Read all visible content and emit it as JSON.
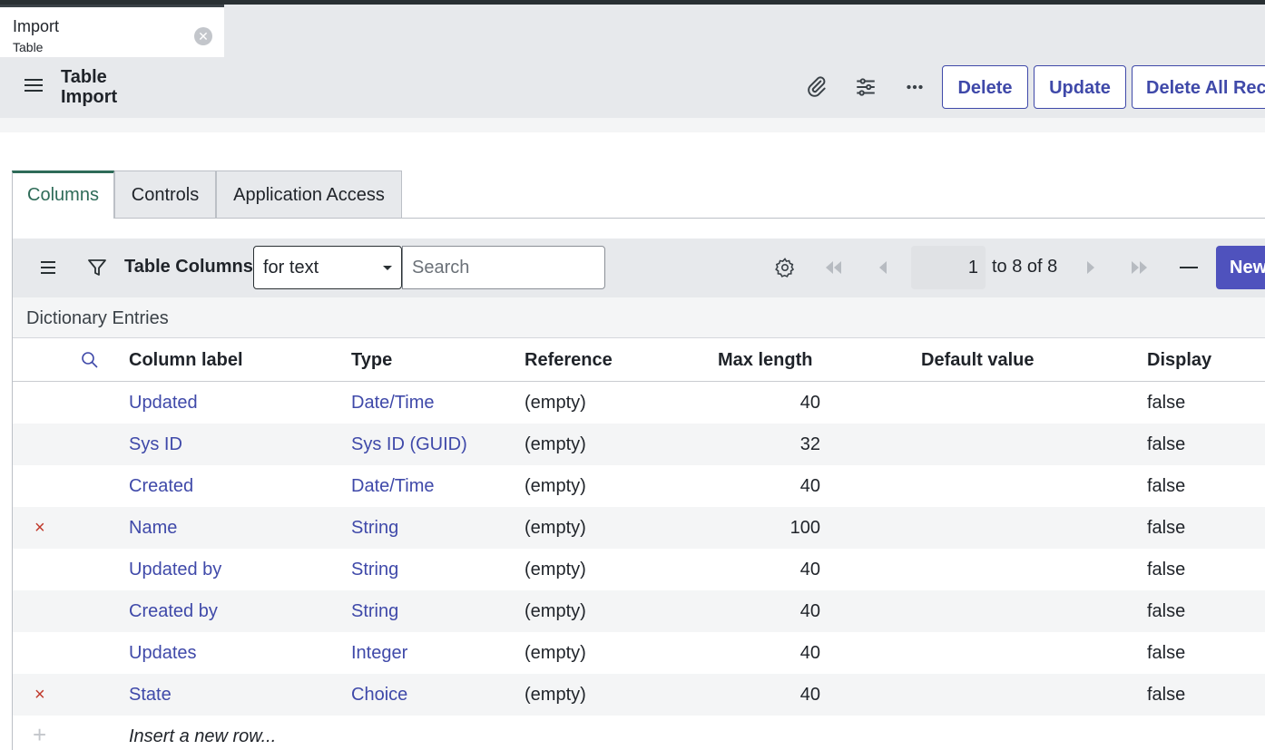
{
  "doc_tab": {
    "title": "Import",
    "subtitle": "Table"
  },
  "header": {
    "title": "Table Import",
    "buttons": {
      "delete": "Delete",
      "update": "Update",
      "delete_all": "Delete All Records"
    }
  },
  "tabs": [
    "Columns",
    "Controls",
    "Application Access"
  ],
  "list": {
    "title": "Table Columns",
    "filter_select": "for text",
    "search_placeholder": "Search",
    "page_value": "1",
    "page_text": "to 8 of 8",
    "new_label": "New",
    "subheader": "Dictionary Entries"
  },
  "columns": [
    "Column label",
    "Type",
    "Reference",
    "Max length",
    "Default value",
    "Display"
  ],
  "rows": [
    {
      "marker": "",
      "label": "Updated",
      "type": "Date/Time",
      "reference": "(empty)",
      "max_length": "40",
      "default": "",
      "display": "false"
    },
    {
      "marker": "",
      "label": "Sys ID",
      "type": "Sys ID (GUID)",
      "reference": "(empty)",
      "max_length": "32",
      "default": "",
      "display": "false"
    },
    {
      "marker": "",
      "label": "Created",
      "type": "Date/Time",
      "reference": "(empty)",
      "max_length": "40",
      "default": "",
      "display": "false"
    },
    {
      "marker": "×",
      "label": "Name",
      "type": "String",
      "reference": "(empty)",
      "max_length": "100",
      "default": "",
      "display": "false"
    },
    {
      "marker": "",
      "label": "Updated by",
      "type": "String",
      "reference": "(empty)",
      "max_length": "40",
      "default": "",
      "display": "false"
    },
    {
      "marker": "",
      "label": "Created by",
      "type": "String",
      "reference": "(empty)",
      "max_length": "40",
      "default": "",
      "display": "false"
    },
    {
      "marker": "",
      "label": "Updates",
      "type": "Integer",
      "reference": "(empty)",
      "max_length": "40",
      "default": "",
      "display": "false"
    },
    {
      "marker": "×",
      "label": "State",
      "type": "Choice",
      "reference": "(empty)",
      "max_length": "40",
      "default": "",
      "display": "false"
    }
  ],
  "insert_row": "Insert a new row...",
  "colors": {
    "accent": "#3f49a9",
    "link": "#3f49a9",
    "tab_active": "#2e6b58",
    "new_button": "#4f52bd",
    "remove": "#c0392b"
  },
  "icons": [
    "close-icon",
    "hamburger-icon",
    "paperclip-icon",
    "sliders-icon",
    "more-icon",
    "filter-icon",
    "gear-icon",
    "first-page-icon",
    "prev-page-icon",
    "next-page-icon",
    "last-page-icon",
    "collapse-icon",
    "search-icon",
    "remove-icon",
    "plus-icon"
  ]
}
